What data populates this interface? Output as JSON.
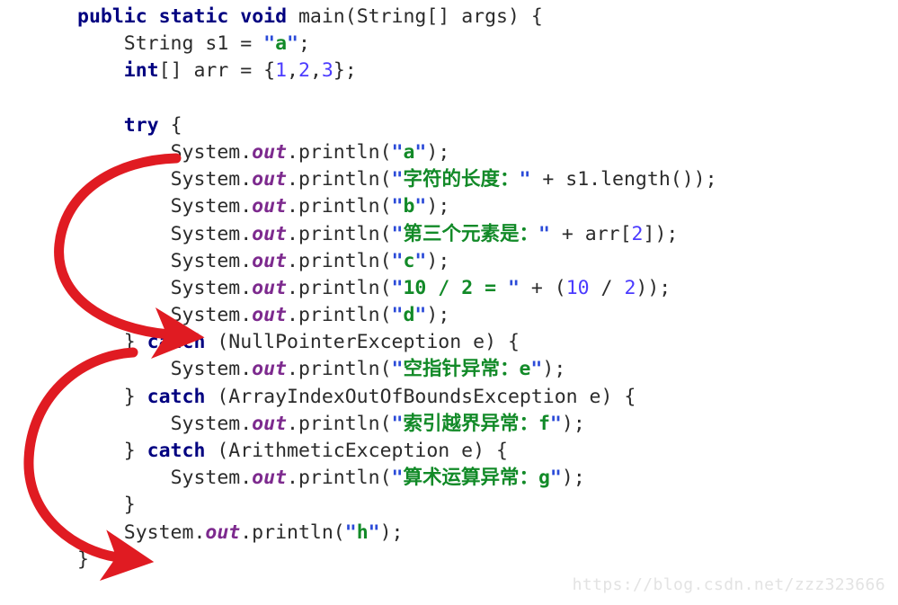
{
  "document": {
    "kind": "java-source-code-snippet",
    "language": "Java",
    "background_color": "#ffffff"
  },
  "theme": {
    "keyword_color": "#000080",
    "plain_text_color": "#2b2b2b",
    "static_field_color": "#7d2a8e",
    "number_color": "#4b3bff",
    "string_quote_color": "#2b4bd8",
    "string_content_color": "#128a28",
    "annotation_arrow_color": "#e01b22",
    "watermark_color": "#e3e3e3"
  },
  "code": {
    "lines": [
      {
        "id": "line-1",
        "indent": 0,
        "tokens": [
          {
            "t": "kw",
            "v": "public"
          },
          {
            "t": "plain",
            "v": " "
          },
          {
            "t": "kw",
            "v": "static"
          },
          {
            "t": "plain",
            "v": " "
          },
          {
            "t": "kw",
            "v": "void"
          },
          {
            "t": "plain",
            "v": " main(String[] args) {"
          }
        ]
      },
      {
        "id": "line-2",
        "indent": 1,
        "tokens": [
          {
            "t": "plain",
            "v": "String s1 = "
          },
          {
            "t": "quote",
            "v": "\""
          },
          {
            "t": "str",
            "v": "a"
          },
          {
            "t": "quote",
            "v": "\""
          },
          {
            "t": "plain",
            "v": ";"
          }
        ]
      },
      {
        "id": "line-3",
        "indent": 1,
        "tokens": [
          {
            "t": "kw",
            "v": "int"
          },
          {
            "t": "plain",
            "v": "[] arr = {"
          },
          {
            "t": "num",
            "v": "1"
          },
          {
            "t": "plain",
            "v": ","
          },
          {
            "t": "num",
            "v": "2"
          },
          {
            "t": "plain",
            "v": ","
          },
          {
            "t": "num",
            "v": "3"
          },
          {
            "t": "plain",
            "v": "};"
          }
        ]
      },
      {
        "id": "line-4",
        "indent": 0,
        "tokens": []
      },
      {
        "id": "line-5",
        "indent": 1,
        "tokens": [
          {
            "t": "kw",
            "v": "try"
          },
          {
            "t": "plain",
            "v": " {"
          }
        ]
      },
      {
        "id": "line-6",
        "indent": 2,
        "tokens": [
          {
            "t": "plain",
            "v": "System."
          },
          {
            "t": "field",
            "v": "out"
          },
          {
            "t": "plain",
            "v": ".println("
          },
          {
            "t": "quote",
            "v": "\""
          },
          {
            "t": "str",
            "v": "a"
          },
          {
            "t": "quote",
            "v": "\""
          },
          {
            "t": "plain",
            "v": ");"
          }
        ]
      },
      {
        "id": "line-7",
        "indent": 2,
        "tokens": [
          {
            "t": "plain",
            "v": "System."
          },
          {
            "t": "field",
            "v": "out"
          },
          {
            "t": "plain",
            "v": ".println("
          },
          {
            "t": "quote",
            "v": "\""
          },
          {
            "t": "str",
            "v": "字符的长度："
          },
          {
            "t": "quote",
            "v": "\""
          },
          {
            "t": "plain",
            "v": " + s1.length());"
          }
        ]
      },
      {
        "id": "line-8",
        "indent": 2,
        "tokens": [
          {
            "t": "plain",
            "v": "System."
          },
          {
            "t": "field",
            "v": "out"
          },
          {
            "t": "plain",
            "v": ".println("
          },
          {
            "t": "quote",
            "v": "\""
          },
          {
            "t": "str",
            "v": "b"
          },
          {
            "t": "quote",
            "v": "\""
          },
          {
            "t": "plain",
            "v": ");"
          }
        ]
      },
      {
        "id": "line-9",
        "indent": 2,
        "tokens": [
          {
            "t": "plain",
            "v": "System."
          },
          {
            "t": "field",
            "v": "out"
          },
          {
            "t": "plain",
            "v": ".println("
          },
          {
            "t": "quote",
            "v": "\""
          },
          {
            "t": "str",
            "v": "第三个元素是："
          },
          {
            "t": "quote",
            "v": "\""
          },
          {
            "t": "plain",
            "v": " + arr["
          },
          {
            "t": "num",
            "v": "2"
          },
          {
            "t": "plain",
            "v": "]);"
          }
        ]
      },
      {
        "id": "line-10",
        "indent": 2,
        "tokens": [
          {
            "t": "plain",
            "v": "System."
          },
          {
            "t": "field",
            "v": "out"
          },
          {
            "t": "plain",
            "v": ".println("
          },
          {
            "t": "quote",
            "v": "\""
          },
          {
            "t": "str",
            "v": "c"
          },
          {
            "t": "quote",
            "v": "\""
          },
          {
            "t": "plain",
            "v": ");"
          }
        ]
      },
      {
        "id": "line-11",
        "indent": 2,
        "tokens": [
          {
            "t": "plain",
            "v": "System."
          },
          {
            "t": "field",
            "v": "out"
          },
          {
            "t": "plain",
            "v": ".println("
          },
          {
            "t": "quote",
            "v": "\""
          },
          {
            "t": "str",
            "v": "10 / 2 = "
          },
          {
            "t": "quote",
            "v": "\""
          },
          {
            "t": "plain",
            "v": " + ("
          },
          {
            "t": "num",
            "v": "10"
          },
          {
            "t": "plain",
            "v": " / "
          },
          {
            "t": "num",
            "v": "2"
          },
          {
            "t": "plain",
            "v": "));"
          }
        ]
      },
      {
        "id": "line-12",
        "indent": 2,
        "tokens": [
          {
            "t": "plain",
            "v": "System."
          },
          {
            "t": "field",
            "v": "out"
          },
          {
            "t": "plain",
            "v": ".println("
          },
          {
            "t": "quote",
            "v": "\""
          },
          {
            "t": "str",
            "v": "d"
          },
          {
            "t": "quote",
            "v": "\""
          },
          {
            "t": "plain",
            "v": ");"
          }
        ]
      },
      {
        "id": "line-13",
        "indent": 1,
        "tokens": [
          {
            "t": "plain",
            "v": "} "
          },
          {
            "t": "kw",
            "v": "catch"
          },
          {
            "t": "plain",
            "v": " (NullPointerException e) {"
          }
        ]
      },
      {
        "id": "line-14",
        "indent": 2,
        "tokens": [
          {
            "t": "plain",
            "v": "System."
          },
          {
            "t": "field",
            "v": "out"
          },
          {
            "t": "plain",
            "v": ".println("
          },
          {
            "t": "quote",
            "v": "\""
          },
          {
            "t": "str",
            "v": "空指针异常：e"
          },
          {
            "t": "quote",
            "v": "\""
          },
          {
            "t": "plain",
            "v": ");"
          }
        ]
      },
      {
        "id": "line-15",
        "indent": 1,
        "tokens": [
          {
            "t": "plain",
            "v": "} "
          },
          {
            "t": "kw",
            "v": "catch"
          },
          {
            "t": "plain",
            "v": " (ArrayIndexOutOfBoundsException e) {"
          }
        ]
      },
      {
        "id": "line-16",
        "indent": 2,
        "tokens": [
          {
            "t": "plain",
            "v": "System."
          },
          {
            "t": "field",
            "v": "out"
          },
          {
            "t": "plain",
            "v": ".println("
          },
          {
            "t": "quote",
            "v": "\""
          },
          {
            "t": "str",
            "v": "索引越界异常：f"
          },
          {
            "t": "quote",
            "v": "\""
          },
          {
            "t": "plain",
            "v": ");"
          }
        ]
      },
      {
        "id": "line-17",
        "indent": 1,
        "tokens": [
          {
            "t": "plain",
            "v": "} "
          },
          {
            "t": "kw",
            "v": "catch"
          },
          {
            "t": "plain",
            "v": " (ArithmeticException e) {"
          }
        ]
      },
      {
        "id": "line-18",
        "indent": 2,
        "tokens": [
          {
            "t": "plain",
            "v": "System."
          },
          {
            "t": "field",
            "v": "out"
          },
          {
            "t": "plain",
            "v": ".println("
          },
          {
            "t": "quote",
            "v": "\""
          },
          {
            "t": "str",
            "v": "算术运算异常：g"
          },
          {
            "t": "quote",
            "v": "\""
          },
          {
            "t": "plain",
            "v": ");"
          }
        ]
      },
      {
        "id": "line-19",
        "indent": 1,
        "tokens": [
          {
            "t": "plain",
            "v": "}"
          }
        ]
      },
      {
        "id": "line-20",
        "indent": 1,
        "tokens": [
          {
            "t": "plain",
            "v": "System."
          },
          {
            "t": "field",
            "v": "out"
          },
          {
            "t": "plain",
            "v": ".println("
          },
          {
            "t": "quote",
            "v": "\""
          },
          {
            "t": "str",
            "v": "h"
          },
          {
            "t": "quote",
            "v": "\""
          },
          {
            "t": "plain",
            "v": ");"
          }
        ]
      },
      {
        "id": "line-21",
        "indent": 0,
        "tokens": [
          {
            "t": "plain",
            "v": "}"
          }
        ]
      }
    ]
  },
  "annotations": {
    "arrow_color": "#e01b22",
    "arrows": [
      {
        "id": "arrow-try-flow",
        "name": "red-curved-arrow-try-block",
        "from_line": "line-6",
        "to_line": "line-12",
        "description": "curved arrow from println(\"a\") down to println(\"d\")"
      },
      {
        "id": "arrow-after-catch-flow",
        "name": "red-curved-arrow-after-catch",
        "from_line": "line-13",
        "to_line": "line-20",
        "description": "curved arrow from catch block down to println(\"h\")"
      }
    ]
  },
  "watermark": {
    "text": "https://blog.csdn.net/zzz323666"
  }
}
